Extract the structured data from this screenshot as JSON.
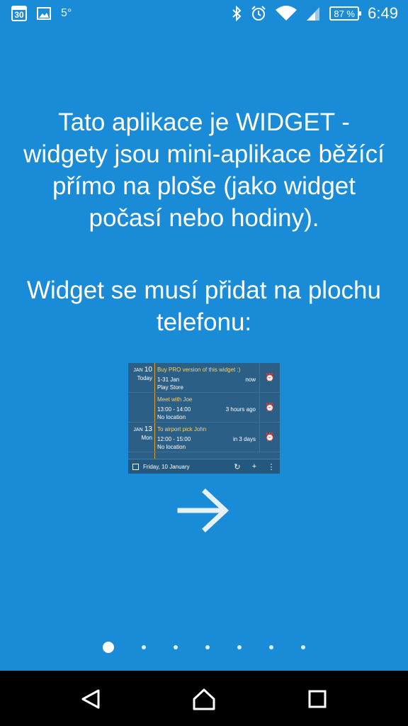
{
  "status_bar": {
    "calendar_day": "30",
    "temperature": "5°",
    "battery": "87 %",
    "time": "6:49",
    "icons": [
      "calendar-icon",
      "gallery-icon",
      "bluetooth-icon",
      "alarm-icon",
      "wifi-icon",
      "signal-icon",
      "battery-icon"
    ]
  },
  "intro": {
    "message1": "Tato aplikace je WIDGET - widgety jsou mini-aplikace běžící přímo na ploše (jako widget počasí nebo hodiny).",
    "message2": "Widget se musí přidat na plochu telefonu:"
  },
  "widget_preview": {
    "events": [
      {
        "month": "JAN",
        "day": "10",
        "sub": "Today",
        "title": "Buy PRO version of this widget :)",
        "time": "1-31 Jan",
        "location": "Play Store",
        "relative": "now"
      },
      {
        "month": "",
        "day": "",
        "sub": "",
        "title": "Meet with Joe",
        "time": "13:00 - 14:00",
        "location": "No location",
        "relative": "3 hours ago"
      },
      {
        "month": "JAN",
        "day": "13",
        "sub": "Mon",
        "title": "To airport pick John",
        "time": "12:00 - 15:00",
        "location": "No location",
        "relative": "in 3 days"
      }
    ],
    "footer_date": "Friday, 10 January"
  },
  "pager": {
    "count": 7,
    "active": 0
  },
  "colors": {
    "background": "#1a8bd6",
    "widget": "#2b5f86",
    "accent": "#e0a030"
  }
}
